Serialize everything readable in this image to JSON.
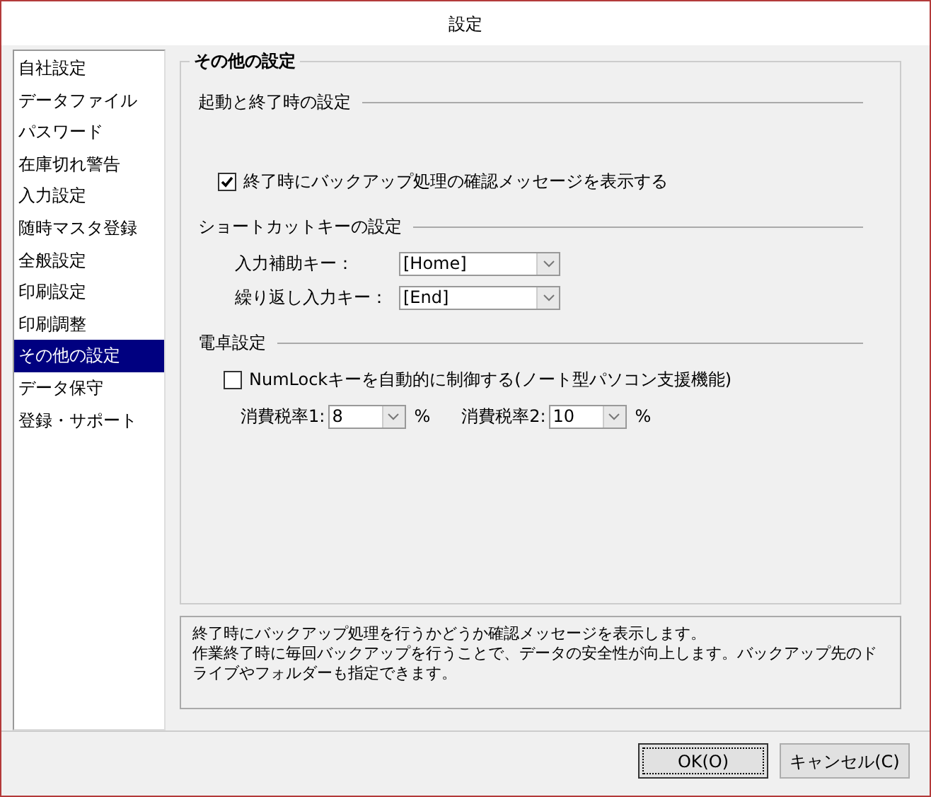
{
  "window": {
    "title": "設定"
  },
  "sidebar": {
    "items": [
      {
        "label": "自社設定",
        "selected": false
      },
      {
        "label": "データファイル",
        "selected": false
      },
      {
        "label": "パスワード",
        "selected": false
      },
      {
        "label": "在庫切れ警告",
        "selected": false
      },
      {
        "label": "入力設定",
        "selected": false
      },
      {
        "label": "随時マスタ登録",
        "selected": false
      },
      {
        "label": "全般設定",
        "selected": false
      },
      {
        "label": "印刷設定",
        "selected": false
      },
      {
        "label": "印刷調整",
        "selected": false
      },
      {
        "label": "その他の設定",
        "selected": true
      },
      {
        "label": "データ保守",
        "selected": false
      },
      {
        "label": "登録・サポート",
        "selected": false
      }
    ]
  },
  "panel": {
    "title": "その他の設定",
    "sections": [
      {
        "title": "起動と終了時の設定",
        "rows": [
          {
            "kind": "checkbox",
            "label": "終了時にバックアップ処理の確認メッセージを表示する",
            "checked": true
          }
        ]
      },
      {
        "title": "ショートカットキーの設定",
        "rows": [
          {
            "kind": "combo",
            "label": "入力補助キー：",
            "value": "[Home]"
          },
          {
            "kind": "combo",
            "label": "繰り返し入力キー：",
            "value": "[End]"
          }
        ]
      },
      {
        "title": "電卓設定",
        "rows": [
          {
            "kind": "checkbox",
            "label": "NumLockキーを自動的に制御する(ノート型パソコン支援機能)",
            "checked": false
          },
          {
            "kind": "rates",
            "items": [
              {
                "label": "消費税率1:",
                "value": "8",
                "unit": "%"
              },
              {
                "label": "消費税率2:",
                "value": "10",
                "unit": "%"
              }
            ]
          }
        ]
      }
    ]
  },
  "description": [
    "終了時にバックアップ処理を行うかどうか確認メッセージを表示します。",
    "作業終了時に毎回バックアップを行うことで、データの安全性が向上します。バックアップ先のドライブやフォルダーも指定できます。"
  ],
  "buttons": [
    {
      "label": "OK(O)",
      "focused": true
    },
    {
      "label": "キャンセル(C)",
      "focused": false
    }
  ]
}
